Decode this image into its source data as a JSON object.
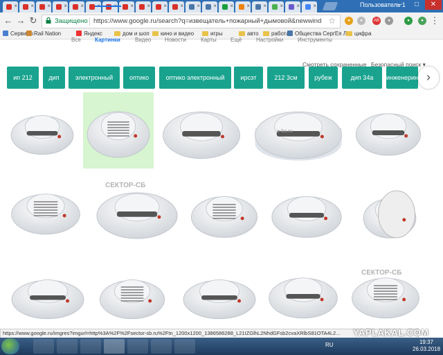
{
  "window": {
    "user_label": "Пользователь 1",
    "tabs": [
      {
        "name": "tab-1",
        "fav": "#d9302a"
      },
      {
        "name": "tab-2",
        "fav": "#d9302a"
      },
      {
        "name": "tab-3",
        "fav": "#d9302a"
      },
      {
        "name": "tab-4",
        "fav": "#d9302a"
      },
      {
        "name": "tab-5",
        "fav": "#d9302a"
      },
      {
        "name": "tab-6",
        "fav": "#d9302a"
      },
      {
        "name": "tab-7",
        "fav": "#d9302a"
      },
      {
        "name": "tab-8",
        "fav": "#d9302a"
      },
      {
        "name": "tab-9",
        "fav": "#d9302a"
      },
      {
        "name": "tab-10",
        "fav": "#d9302a"
      },
      {
        "name": "tab-11",
        "fav": "#d9302a"
      },
      {
        "name": "tab-12",
        "fav": "#4a76a8"
      },
      {
        "name": "tab-13",
        "fav": "#4a76a8"
      },
      {
        "name": "tab-14",
        "fav": "#1a9e3f"
      },
      {
        "name": "tab-15",
        "fav": "#ee8208"
      },
      {
        "name": "tab-16",
        "fav": "#4a76a8"
      },
      {
        "name": "tab-17",
        "fav": "#4caf50"
      },
      {
        "name": "tab-18",
        "fav": "#6a5acd"
      },
      {
        "name": "tab-19",
        "fav": "#4285f4"
      }
    ]
  },
  "addressbar": {
    "secure_label": "Защищено",
    "url": "https://www.google.ru/search?q=извещатель+пожарный+дымовой&newwindow=1&s..."
  },
  "bookmarks": [
    {
      "label": "Сервисы",
      "icon": "apps-icon"
    },
    {
      "label": "Rail Nation",
      "icon": "railnation-icon"
    },
    {
      "label": "Яндекс",
      "icon": "yandex-icon"
    },
    {
      "label": "дом и шоп",
      "icon": "folder-icon"
    },
    {
      "label": "кино и видео",
      "icon": "folder-icon"
    },
    {
      "label": "игры",
      "icon": "folder-icon"
    },
    {
      "label": "авто",
      "icon": "folder-icon"
    },
    {
      "label": "работа",
      "icon": "folder-icon"
    },
    {
      "label": "Общества СергЕя Л",
      "icon": "vk-icon"
    },
    {
      "label": "цифра",
      "icon": "folder-icon"
    }
  ],
  "google_nav": {
    "tabs": [
      "Все",
      "Картинки",
      "Видео",
      "Новости",
      "Карты",
      "Ещё",
      "Настройки",
      "Инструменты"
    ],
    "saved": "Смотреть сохраненные",
    "safesearch": "Безопасный поиск"
  },
  "chips": [
    "ип 212",
    "дип",
    "электронный",
    "оптико",
    "оптико электронный",
    "ирсэт",
    "212 3см",
    "рубеж",
    "дип 34а",
    "инженерин"
  ],
  "grid_watermarks": {
    "sektor": "СЕКТОР-СБ",
    "ekc": "e-kc.ru"
  },
  "status_url": "https://www.google.ru/imgres?imgurl=http%3A%2F%2Fsector-sb.ru%2Ftn_1200x1200_1386586288_L21IZGlhL2NhdGFsb2cvaXRlbS81OTA4L2...",
  "watermark": "YAPLAKAL.COM",
  "taskbar": {
    "lang": "RU",
    "time": "19:37",
    "date": "26.03.2018"
  }
}
